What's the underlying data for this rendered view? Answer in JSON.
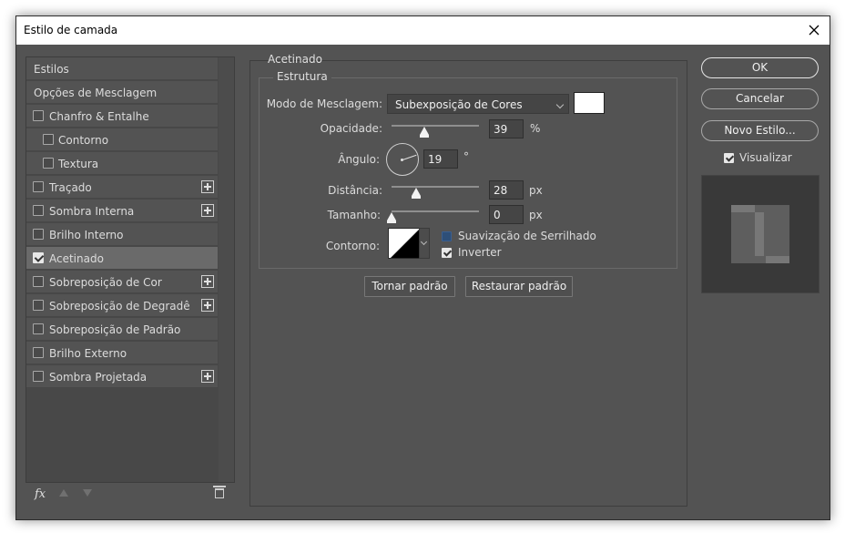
{
  "window": {
    "title": "Estilo de camada"
  },
  "styles_list": [
    {
      "label": "Estilos",
      "checkbox": false,
      "checked": false,
      "indent": false,
      "plus": false,
      "selected": false
    },
    {
      "label": "Opções de Mesclagem",
      "checkbox": false,
      "checked": false,
      "indent": false,
      "plus": false,
      "selected": false
    },
    {
      "label": "Chanfro & Entalhe",
      "checkbox": true,
      "checked": false,
      "indent": false,
      "plus": false,
      "selected": false
    },
    {
      "label": "Contorno",
      "checkbox": true,
      "checked": false,
      "indent": true,
      "plus": false,
      "selected": false
    },
    {
      "label": "Textura",
      "checkbox": true,
      "checked": false,
      "indent": true,
      "plus": false,
      "selected": false
    },
    {
      "label": "Traçado",
      "checkbox": true,
      "checked": false,
      "indent": false,
      "plus": true,
      "selected": false
    },
    {
      "label": "Sombra Interna",
      "checkbox": true,
      "checked": false,
      "indent": false,
      "plus": true,
      "selected": false
    },
    {
      "label": "Brilho Interno",
      "checkbox": true,
      "checked": false,
      "indent": false,
      "plus": false,
      "selected": false
    },
    {
      "label": "Acetinado",
      "checkbox": true,
      "checked": true,
      "indent": false,
      "plus": false,
      "selected": true
    },
    {
      "label": "Sobreposição de Cor",
      "checkbox": true,
      "checked": false,
      "indent": false,
      "plus": true,
      "selected": false
    },
    {
      "label": "Sobreposição de Degradê",
      "checkbox": true,
      "checked": false,
      "indent": false,
      "plus": true,
      "selected": false
    },
    {
      "label": "Sobreposição de Padrão",
      "checkbox": true,
      "checked": false,
      "indent": false,
      "plus": false,
      "selected": false
    },
    {
      "label": "Brilho Externo",
      "checkbox": true,
      "checked": false,
      "indent": false,
      "plus": false,
      "selected": false
    },
    {
      "label": "Sombra Projetada",
      "checkbox": true,
      "checked": false,
      "indent": false,
      "plus": true,
      "selected": false
    }
  ],
  "bottom_bar": {
    "fx_label": "fx"
  },
  "panel": {
    "group_title": "Acetinado",
    "structure_title": "Estrutura",
    "blend_mode_label": "Modo de Mesclagem:",
    "blend_mode_value": "Subexposição de Cores",
    "color_swatch": "#ffffff",
    "opacity_label": "Opacidade:",
    "opacity_value": "39",
    "opacity_unit": "%",
    "angle_label": "Ângulo:",
    "angle_value": "19",
    "angle_unit": "°",
    "distance_label": "Distância:",
    "distance_value": "28",
    "distance_unit": "px",
    "size_label": "Tamanho:",
    "size_value": "0",
    "size_unit": "px",
    "contour_label": "Contorno:",
    "anti_alias_label": "Suavização de Serrilhado",
    "anti_alias_checked": false,
    "invert_label": "Inverter",
    "invert_checked": true,
    "make_default_label": "Tornar padrão",
    "reset_default_label": "Restaurar padrão"
  },
  "right": {
    "ok_label": "OK",
    "cancel_label": "Cancelar",
    "new_style_label": "Novo Estilo...",
    "preview_label": "Visualizar",
    "preview_checked": true
  },
  "colors": {
    "dialog_bg": "#535353",
    "selected_row": "#6a6a6a",
    "accent_checkbox": "#2e4f78"
  }
}
